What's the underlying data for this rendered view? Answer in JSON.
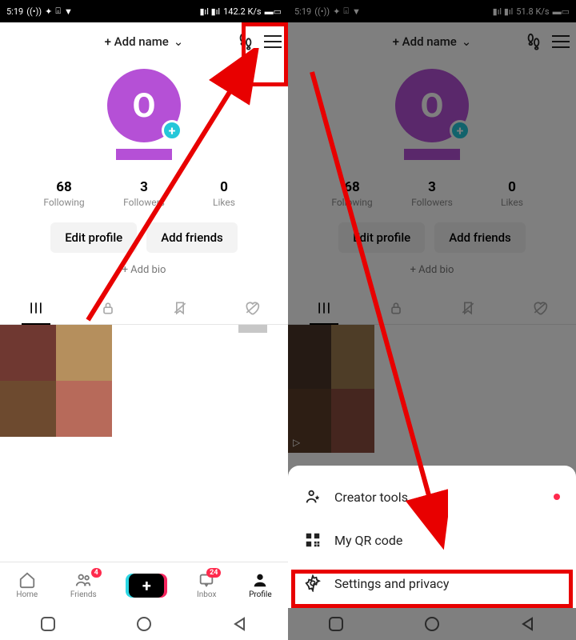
{
  "statusbar": {
    "time": "5:19",
    "net_left": "142.2 K/s",
    "net_right": "51.8 K/s"
  },
  "topbar": {
    "add_name": "+ Add name"
  },
  "avatar": {
    "letter": "O"
  },
  "stats": {
    "following": {
      "num": "68",
      "label": "Following"
    },
    "followers": {
      "num": "3",
      "label": "Followers"
    },
    "likes": {
      "num": "0",
      "label": "Likes"
    }
  },
  "buttons": {
    "edit": "Edit profile",
    "addfriends": "Add friends",
    "addbio": "+ Add bio"
  },
  "bottomnav": {
    "home": "Home",
    "friends": "Friends",
    "inbox": "Inbox",
    "profile": "Profile",
    "friends_badge": "4",
    "inbox_badge": "24"
  },
  "sheet": {
    "creator": "Creator tools",
    "qr": "My QR code",
    "settings": "Settings and privacy"
  }
}
